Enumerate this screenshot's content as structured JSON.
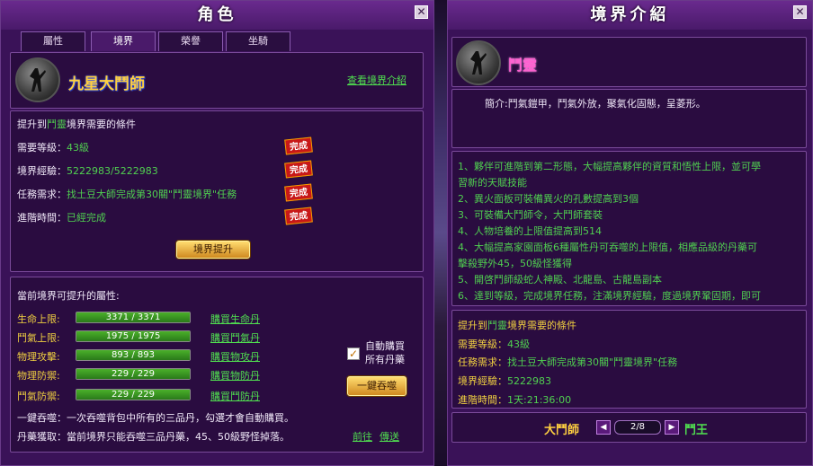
{
  "left_window": {
    "title": "角色",
    "tabs": [
      "屬性",
      "境界",
      "榮譽",
      "坐騎"
    ],
    "active_tab": "境界",
    "realm_name": "九星大鬥師",
    "view_intro_link": "查看境界介紹",
    "req_title_prefix": "提升到",
    "req_title_realm": "鬥靈",
    "req_title_suffix": "境界需要的條件",
    "requirements": [
      {
        "label": "需要等級：",
        "value": "43級",
        "status": "完成"
      },
      {
        "label": "境界經驗：",
        "value": "5222983",
        "value2": "5222983",
        "status": "完成"
      },
      {
        "label": "任務需求：",
        "value": "找土豆大師完成第30關\"鬥靈境界\"任務",
        "status": "完成"
      },
      {
        "label": "進階時間：",
        "value": "已經完成",
        "status": "完成"
      }
    ],
    "upgrade_button": "境界提升",
    "attr_title": "當前境界可提升的屬性:",
    "attributes": [
      {
        "label": "生命上限:",
        "value": "3371 / 3371",
        "fill": 1.0,
        "buy": "購買生命丹"
      },
      {
        "label": "鬥氣上限:",
        "value": "1975 / 1975",
        "fill": 1.0,
        "buy": "購買鬥氣丹"
      },
      {
        "label": "物理攻擊:",
        "value": "893 / 893",
        "fill": 1.0,
        "buy": "購買物攻丹"
      },
      {
        "label": "物理防禦:",
        "value": "229 / 229",
        "fill": 1.0,
        "buy": "購買物防丹"
      },
      {
        "label": "鬥氣防禦:",
        "value": "229 / 229",
        "fill": 1.0,
        "buy": "購買鬥防丹"
      }
    ],
    "auto_buy_line1": "自動購買",
    "auto_buy_line2": "所有丹藥",
    "auto_buy_checked": true,
    "one_click_button": "一鍵吞噬",
    "note1": "一鍵吞噬：一次吞噬背包中所有的三品丹，勾選才會自動購買。",
    "note2": "丹藥獲取：當前境界只能吞噬三品丹藥，45、50級野怪掉落。",
    "goto_link": "前往",
    "teleport_link": "傳送"
  },
  "right_window": {
    "title": "境界介紹",
    "realm_name": "鬥靈",
    "intro": "簡介:鬥氣鎧甲，鬥氣外放，聚氣化固態，呈菱形。",
    "benefits": [
      "1、夥伴可進階到第二形態，大幅提高夥伴的資質和悟性上限，並可學",
      "習新的天賦技能",
      "2、異火面板可裝備異火的孔數提高到3個",
      "3、可裝備大鬥師令，大鬥師套裝",
      "4、人物培養的上限值提高到514",
      "4、大幅提高家園面板6種屬性丹可吞噬的上限值，相應品級的丹藥可",
      "擊殺野外45，50級怪獲得",
      "5、開啓鬥師級蛇人神殿、北龍島、古龍島副本",
      "6、達到等級，完成境界任務，注滿境界經驗，度過境界鞏固期，即可"
    ],
    "req_title_prefix": "提升到",
    "req_title_realm": "鬥靈",
    "req_title_suffix": "境界需要的條件",
    "requirements": [
      {
        "label": "需要等級：",
        "value": "43級"
      },
      {
        "label": "任務需求：",
        "value": "找土豆大師完成第30關\"鬥靈境界\"任務"
      },
      {
        "label": "境界經驗：",
        "value": "5222983"
      },
      {
        "label": "進階時間：",
        "value": "1天:21:36:00"
      }
    ],
    "nav_prev_name": "大鬥師",
    "page": "2/8",
    "nav_next_name": "鬥王"
  }
}
